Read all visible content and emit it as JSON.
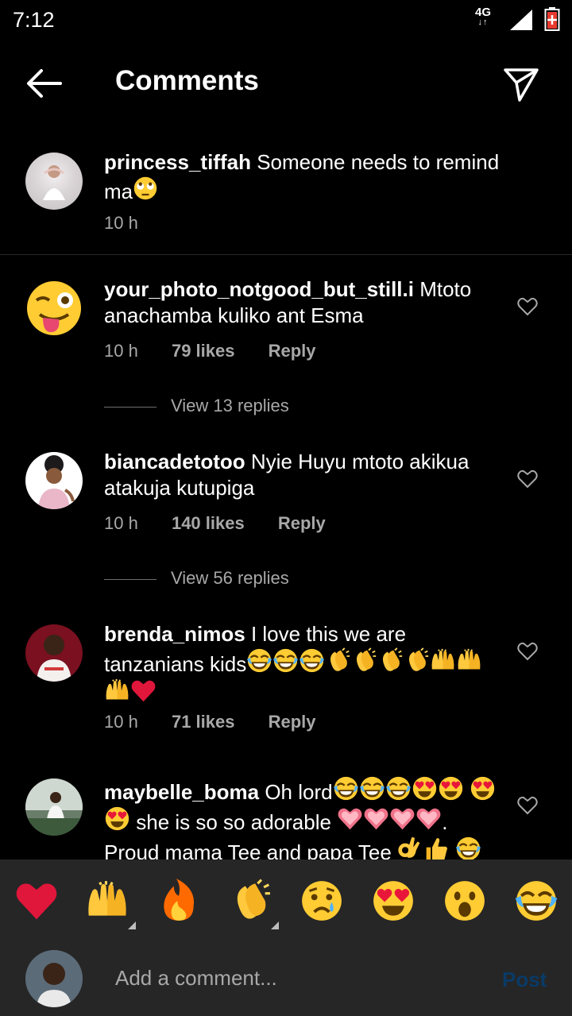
{
  "status_bar": {
    "time": "7:12",
    "network": "4G"
  },
  "header": {
    "title": "Comments"
  },
  "caption": {
    "username": "princess_tiffah",
    "text": "Someone needs to remind ma",
    "time": "10 h"
  },
  "comments": [
    {
      "username": "your_photo_notgood_but_still.i",
      "text": "Mtoto anachamba kuliko ant Esma",
      "time": "10 h",
      "likes": "79 likes",
      "reply": "Reply",
      "view_replies": "View 13 replies"
    },
    {
      "username": "biancadetotoo",
      "text": "Nyie Huyu mtoto akikua atakuja kutupiga",
      "time": "10 h",
      "likes": "140 likes",
      "reply": "Reply",
      "view_replies": "View 56 replies"
    },
    {
      "username": "brenda_nimos",
      "text": "I love this we are tanzanians kids",
      "time": "10 h",
      "likes": "71 likes",
      "reply": "Reply"
    },
    {
      "username": "maybelle_boma",
      "text1": "Oh lord",
      "text2": "she is so so adorable",
      "text3": "Proud mama Tee and papa Tee"
    }
  ],
  "reactions": [
    "heart",
    "raised-hands",
    "fire",
    "clapping-hands",
    "crying-face",
    "heart-eyes",
    "astonished-face",
    "tears-of-joy"
  ],
  "input": {
    "placeholder": "Add a comment...",
    "post_label": "Post"
  },
  "colors": {
    "background": "#000000",
    "secondary_text": "#a8a8a8",
    "post_disabled": "#0a3a66",
    "bar": "#262626"
  }
}
